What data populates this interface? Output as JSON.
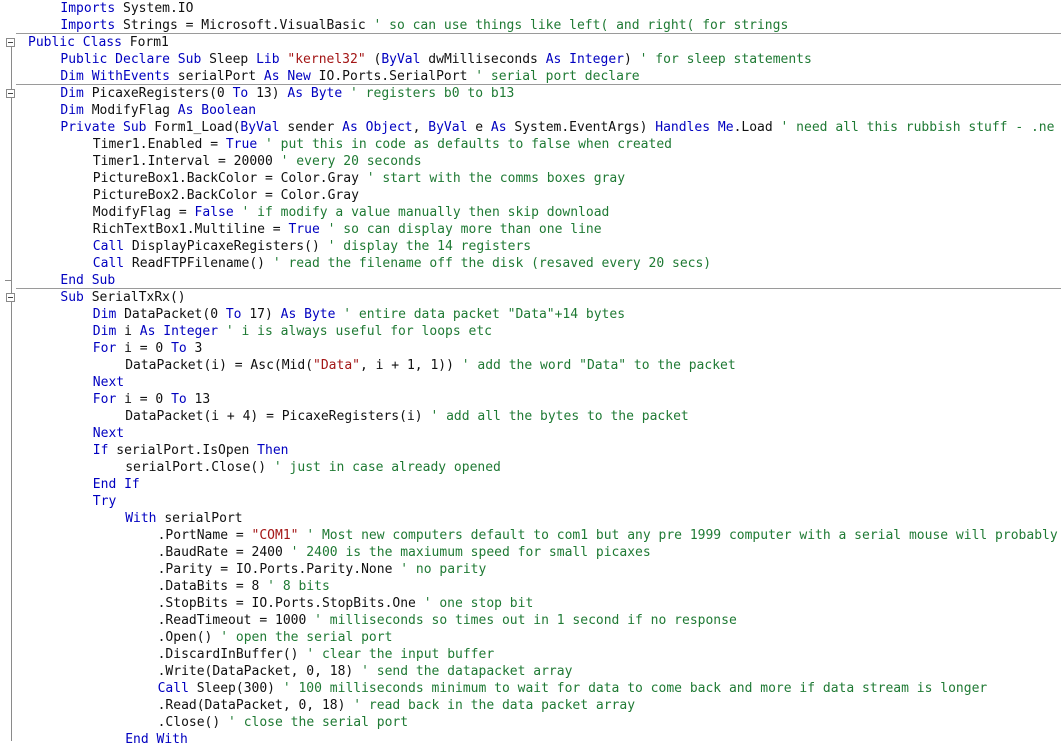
{
  "editor": {
    "language": "Visual Basic .NET",
    "font_size_px": 13,
    "line_height_px": 17,
    "colors": {
      "background": "#ffffff",
      "keyword": "#0000c0",
      "comment": "#1f7a34",
      "string": "#a31515",
      "identifier": "#101010",
      "gutter_line": "#8a8a8a",
      "separator": "#9a9a9a"
    }
  },
  "gutter": {
    "outline_boxes": [
      {
        "name": "collapse-box-public-class",
        "line": 2
      },
      {
        "name": "collapse-box-form1-load",
        "line": 5
      },
      {
        "name": "collapse-box-serialtxrx",
        "line": 17
      }
    ],
    "end_ticks": [
      {
        "name": "region-end-tick-form1-load",
        "line": 15
      }
    ],
    "separators": [
      {
        "name": "separator-after-imports",
        "line": 2
      },
      {
        "name": "separator-before-form1-load",
        "line": 5
      },
      {
        "name": "separator-before-serialtxrx",
        "line": 17
      }
    ]
  },
  "code": {
    "lines": [
      {
        "n": 0,
        "indent": 1,
        "tokens": [
          {
            "t": "kw",
            "s": "Imports"
          },
          {
            "t": "id",
            "s": " System.IO"
          }
        ]
      },
      {
        "n": 1,
        "indent": 1,
        "tokens": [
          {
            "t": "kw",
            "s": "Imports"
          },
          {
            "t": "id",
            "s": " Strings = Microsoft.VisualBasic "
          },
          {
            "t": "cm",
            "s": "' so can use things like left( and right( for strings"
          }
        ]
      },
      {
        "n": 2,
        "indent": 0,
        "tokens": [
          {
            "t": "kw",
            "s": "Public Class"
          },
          {
            "t": "id",
            "s": " Form1"
          }
        ]
      },
      {
        "n": 3,
        "indent": 1,
        "tokens": [
          {
            "t": "kw",
            "s": "Public Declare Sub"
          },
          {
            "t": "id",
            "s": " Sleep "
          },
          {
            "t": "kw",
            "s": "Lib"
          },
          {
            "t": "id",
            "s": " "
          },
          {
            "t": "str",
            "s": "\"kernel32\""
          },
          {
            "t": "id",
            "s": " ("
          },
          {
            "t": "kw",
            "s": "ByVal"
          },
          {
            "t": "id",
            "s": " dwMilliseconds "
          },
          {
            "t": "kw",
            "s": "As Integer"
          },
          {
            "t": "id",
            "s": ") "
          },
          {
            "t": "cm",
            "s": "' for sleep statements"
          }
        ]
      },
      {
        "n": 4,
        "indent": 1,
        "tokens": [
          {
            "t": "kw",
            "s": "Dim WithEvents"
          },
          {
            "t": "id",
            "s": " serialPort "
          },
          {
            "t": "kw",
            "s": "As New"
          },
          {
            "t": "id",
            "s": " IO.Ports.SerialPort "
          },
          {
            "t": "cm",
            "s": "' serial port declare"
          }
        ]
      },
      {
        "n": 5,
        "indent": 1,
        "tokens": [
          {
            "t": "kw",
            "s": "Dim"
          },
          {
            "t": "id",
            "s": " PicaxeRegisters(0 "
          },
          {
            "t": "kw",
            "s": "To"
          },
          {
            "t": "id",
            "s": " 13) "
          },
          {
            "t": "kw",
            "s": "As Byte"
          },
          {
            "t": "id",
            "s": " "
          },
          {
            "t": "cm",
            "s": "' registers b0 to b13"
          }
        ]
      },
      {
        "n": 6,
        "indent": 1,
        "tokens": [
          {
            "t": "kw",
            "s": "Dim"
          },
          {
            "t": "id",
            "s": " ModifyFlag "
          },
          {
            "t": "kw",
            "s": "As Boolean"
          }
        ]
      },
      {
        "n": 7,
        "indent": 1,
        "tokens": [
          {
            "t": "kw",
            "s": "Private Sub"
          },
          {
            "t": "id",
            "s": " Form1_Load("
          },
          {
            "t": "kw",
            "s": "ByVal"
          },
          {
            "t": "id",
            "s": " sender "
          },
          {
            "t": "kw",
            "s": "As Object"
          },
          {
            "t": "id",
            "s": ", "
          },
          {
            "t": "kw",
            "s": "ByVal"
          },
          {
            "t": "id",
            "s": " e "
          },
          {
            "t": "kw",
            "s": "As"
          },
          {
            "t": "id",
            "s": " System.EventArgs) "
          },
          {
            "t": "kw",
            "s": "Handles Me"
          },
          {
            "t": "id",
            "s": ".Load "
          },
          {
            "t": "cm",
            "s": "' need all this rubbish stuff - .ne"
          }
        ]
      },
      {
        "n": 8,
        "indent": 2,
        "tokens": [
          {
            "t": "id",
            "s": "Timer1.Enabled = "
          },
          {
            "t": "kw",
            "s": "True"
          },
          {
            "t": "id",
            "s": " "
          },
          {
            "t": "cm",
            "s": "' put this in code as defaults to false when created"
          }
        ]
      },
      {
        "n": 9,
        "indent": 2,
        "tokens": [
          {
            "t": "id",
            "s": "Timer1.Interval = 20000 "
          },
          {
            "t": "cm",
            "s": "' every 20 seconds"
          }
        ]
      },
      {
        "n": 10,
        "indent": 2,
        "tokens": [
          {
            "t": "id",
            "s": "PictureBox1.BackColor = Color.Gray "
          },
          {
            "t": "cm",
            "s": "' start with the comms boxes gray"
          }
        ]
      },
      {
        "n": 11,
        "indent": 2,
        "tokens": [
          {
            "t": "id",
            "s": "PictureBox2.BackColor = Color.Gray"
          }
        ]
      },
      {
        "n": 12,
        "indent": 2,
        "tokens": [
          {
            "t": "id",
            "s": "ModifyFlag = "
          },
          {
            "t": "kw",
            "s": "False"
          },
          {
            "t": "id",
            "s": " "
          },
          {
            "t": "cm",
            "s": "' if modify a value manually then skip download"
          }
        ]
      },
      {
        "n": 13,
        "indent": 2,
        "tokens": [
          {
            "t": "id",
            "s": "RichTextBox1.Multiline = "
          },
          {
            "t": "kw",
            "s": "True"
          },
          {
            "t": "id",
            "s": " "
          },
          {
            "t": "cm",
            "s": "' so can display more than one line"
          }
        ]
      },
      {
        "n": 14,
        "indent": 2,
        "tokens": [
          {
            "t": "kw",
            "s": "Call"
          },
          {
            "t": "id",
            "s": " DisplayPicaxeRegisters() "
          },
          {
            "t": "cm",
            "s": "' display the 14 registers"
          }
        ]
      },
      {
        "n": 15,
        "indent": 2,
        "tokens": [
          {
            "t": "kw",
            "s": "Call"
          },
          {
            "t": "id",
            "s": " ReadFTPFilename() "
          },
          {
            "t": "cm",
            "s": "' read the filename off the disk (resaved every 20 secs)"
          }
        ]
      },
      {
        "n": 16,
        "indent": 1,
        "tokens": [
          {
            "t": "kw",
            "s": "End Sub"
          }
        ]
      },
      {
        "n": 17,
        "indent": 1,
        "tokens": [
          {
            "t": "kw",
            "s": "Sub"
          },
          {
            "t": "id",
            "s": " SerialTxRx()"
          }
        ]
      },
      {
        "n": 18,
        "indent": 2,
        "tokens": [
          {
            "t": "kw",
            "s": "Dim"
          },
          {
            "t": "id",
            "s": " DataPacket(0 "
          },
          {
            "t": "kw",
            "s": "To"
          },
          {
            "t": "id",
            "s": " 17) "
          },
          {
            "t": "kw",
            "s": "As Byte"
          },
          {
            "t": "id",
            "s": " "
          },
          {
            "t": "cm",
            "s": "' entire data packet \"Data\"+14 bytes"
          }
        ]
      },
      {
        "n": 19,
        "indent": 2,
        "tokens": [
          {
            "t": "kw",
            "s": "Dim"
          },
          {
            "t": "id",
            "s": " i "
          },
          {
            "t": "kw",
            "s": "As Integer"
          },
          {
            "t": "id",
            "s": " "
          },
          {
            "t": "cm",
            "s": "' i is always useful for loops etc"
          }
        ]
      },
      {
        "n": 20,
        "indent": 2,
        "tokens": [
          {
            "t": "kw",
            "s": "For"
          },
          {
            "t": "id",
            "s": " i = 0 "
          },
          {
            "t": "kw",
            "s": "To"
          },
          {
            "t": "id",
            "s": " 3"
          }
        ]
      },
      {
        "n": 21,
        "indent": 3,
        "tokens": [
          {
            "t": "id",
            "s": "DataPacket(i) = Asc(Mid("
          },
          {
            "t": "str",
            "s": "\"Data\""
          },
          {
            "t": "id",
            "s": ", i + 1, 1)) "
          },
          {
            "t": "cm",
            "s": "' add the word \"Data\" to the packet"
          }
        ]
      },
      {
        "n": 22,
        "indent": 2,
        "tokens": [
          {
            "t": "kw",
            "s": "Next"
          }
        ]
      },
      {
        "n": 23,
        "indent": 2,
        "tokens": [
          {
            "t": "kw",
            "s": "For"
          },
          {
            "t": "id",
            "s": " i = 0 "
          },
          {
            "t": "kw",
            "s": "To"
          },
          {
            "t": "id",
            "s": " 13"
          }
        ]
      },
      {
        "n": 24,
        "indent": 3,
        "tokens": [
          {
            "t": "id",
            "s": "DataPacket(i + 4) = PicaxeRegisters(i) "
          },
          {
            "t": "cm",
            "s": "' add all the bytes to the packet"
          }
        ]
      },
      {
        "n": 25,
        "indent": 2,
        "tokens": [
          {
            "t": "kw",
            "s": "Next"
          }
        ]
      },
      {
        "n": 26,
        "indent": 2,
        "tokens": [
          {
            "t": "kw",
            "s": "If"
          },
          {
            "t": "id",
            "s": " serialPort.IsOpen "
          },
          {
            "t": "kw",
            "s": "Then"
          }
        ]
      },
      {
        "n": 27,
        "indent": 3,
        "tokens": [
          {
            "t": "id",
            "s": "serialPort.Close() "
          },
          {
            "t": "cm",
            "s": "' just in case already opened"
          }
        ]
      },
      {
        "n": 28,
        "indent": 2,
        "tokens": [
          {
            "t": "kw",
            "s": "End If"
          }
        ]
      },
      {
        "n": 29,
        "indent": 2,
        "tokens": [
          {
            "t": "kw",
            "s": "Try"
          }
        ]
      },
      {
        "n": 30,
        "indent": 3,
        "tokens": [
          {
            "t": "kw",
            "s": "With"
          },
          {
            "t": "id",
            "s": " serialPort"
          }
        ]
      },
      {
        "n": 31,
        "indent": 4,
        "tokens": [
          {
            "t": "id",
            "s": ".PortName = "
          },
          {
            "t": "str",
            "s": "\"COM1\""
          },
          {
            "t": "id",
            "s": " "
          },
          {
            "t": "cm",
            "s": "' Most new computers default to com1 but any pre 1999 computer with a serial mouse will probably"
          }
        ]
      },
      {
        "n": 32,
        "indent": 4,
        "tokens": [
          {
            "t": "id",
            "s": ".BaudRate = 2400 "
          },
          {
            "t": "cm",
            "s": "' 2400 is the maxiumum speed for small picaxes"
          }
        ]
      },
      {
        "n": 33,
        "indent": 4,
        "tokens": [
          {
            "t": "id",
            "s": ".Parity = IO.Ports.Parity.None "
          },
          {
            "t": "cm",
            "s": "' no parity"
          }
        ]
      },
      {
        "n": 34,
        "indent": 4,
        "tokens": [
          {
            "t": "id",
            "s": ".DataBits = 8 "
          },
          {
            "t": "cm",
            "s": "' 8 bits"
          }
        ]
      },
      {
        "n": 35,
        "indent": 4,
        "tokens": [
          {
            "t": "id",
            "s": ".StopBits = IO.Ports.StopBits.One "
          },
          {
            "t": "cm",
            "s": "' one stop bit"
          }
        ]
      },
      {
        "n": 36,
        "indent": 4,
        "tokens": [
          {
            "t": "id",
            "s": ".ReadTimeout = 1000 "
          },
          {
            "t": "cm",
            "s": "' milliseconds so times out in 1 second if no response"
          }
        ]
      },
      {
        "n": 37,
        "indent": 4,
        "tokens": [
          {
            "t": "id",
            "s": ".Open() "
          },
          {
            "t": "cm",
            "s": "' open the serial port"
          }
        ]
      },
      {
        "n": 38,
        "indent": 4,
        "tokens": [
          {
            "t": "id",
            "s": ".DiscardInBuffer() "
          },
          {
            "t": "cm",
            "s": "' clear the input buffer"
          }
        ]
      },
      {
        "n": 39,
        "indent": 4,
        "tokens": [
          {
            "t": "id",
            "s": ".Write(DataPacket, 0, 18) "
          },
          {
            "t": "cm",
            "s": "' send the datapacket array"
          }
        ]
      },
      {
        "n": 40,
        "indent": 4,
        "tokens": [
          {
            "t": "kw",
            "s": "Call"
          },
          {
            "t": "id",
            "s": " Sleep(300) "
          },
          {
            "t": "cm",
            "s": "' 100 milliseconds minimum to wait for data to come back and more if data stream is longer"
          }
        ]
      },
      {
        "n": 41,
        "indent": 4,
        "tokens": [
          {
            "t": "id",
            "s": ".Read(DataPacket, 0, 18) "
          },
          {
            "t": "cm",
            "s": "' read back in the data packet array"
          }
        ]
      },
      {
        "n": 42,
        "indent": 4,
        "tokens": [
          {
            "t": "id",
            "s": ".Close() "
          },
          {
            "t": "cm",
            "s": "' close the serial port"
          }
        ]
      },
      {
        "n": 43,
        "indent": 3,
        "tokens": [
          {
            "t": "kw",
            "s": "End With"
          }
        ]
      }
    ]
  }
}
